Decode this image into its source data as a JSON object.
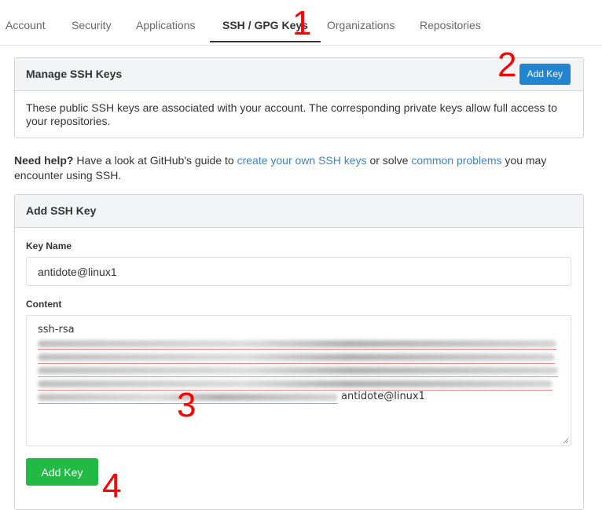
{
  "tabs": [
    {
      "label": "Account"
    },
    {
      "label": "Security"
    },
    {
      "label": "Applications"
    },
    {
      "label": "SSH / GPG Keys"
    },
    {
      "label": "Organizations"
    },
    {
      "label": "Repositories"
    }
  ],
  "annotations": [
    "1",
    "2",
    "3",
    "4"
  ],
  "manage_panel": {
    "title": "Manage SSH Keys",
    "add_key_label": "Add Key",
    "description": "These public SSH keys are associated with your account. The corresponding private keys allow full access to your repositories."
  },
  "help": {
    "prefix": "Need help?",
    "text1": " Have a look at GitHub's guide to ",
    "link1": "create your own SSH keys",
    "text2": " or solve ",
    "link2": "common problems",
    "text3": " you may encounter using SSH."
  },
  "add_panel": {
    "title": "Add SSH Key",
    "key_name_label": "Key Name",
    "key_name_value": "antidote@linux1",
    "content_label": "Content",
    "content_first_line": "ssh-rsa",
    "content_suffix": "antidote@linux1",
    "submit_label": "Add Key"
  },
  "colors": {
    "primary_button": "#2185d0",
    "submit_button": "#21ba45",
    "link": "#4183c4",
    "annotation": "#ff0000"
  }
}
